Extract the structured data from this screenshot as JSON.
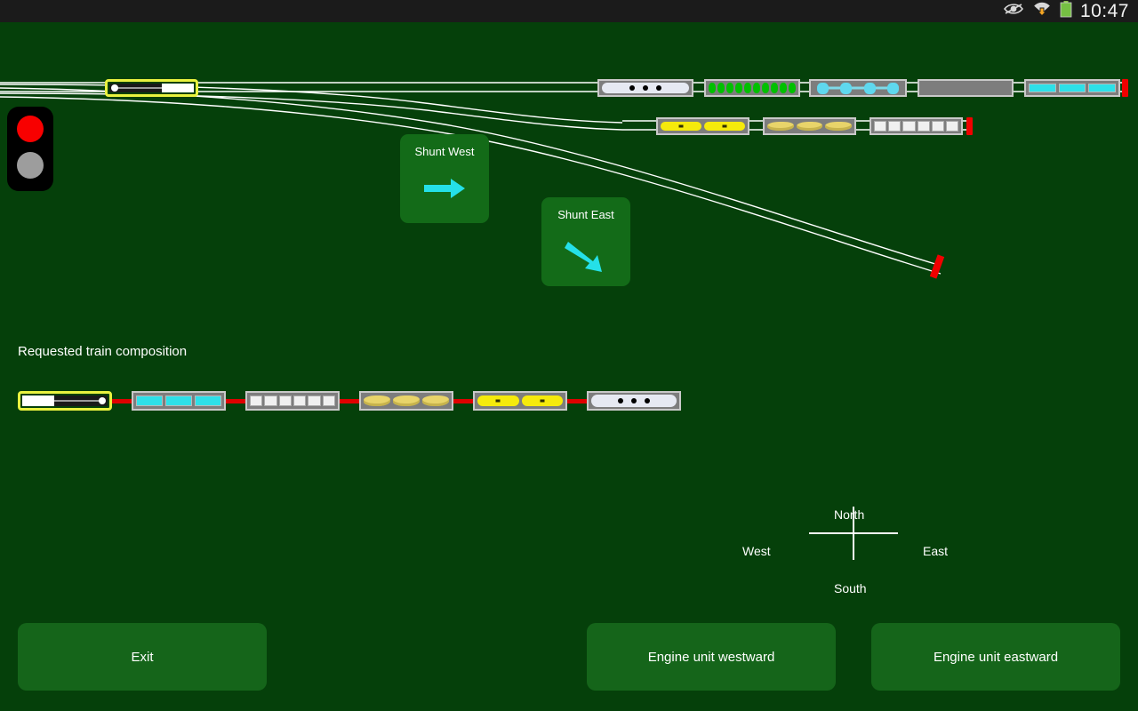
{
  "statusbar": {
    "clock": "10:47",
    "icons": [
      "eye-icon",
      "wifi-download-icon",
      "battery-icon"
    ]
  },
  "signal": {
    "name": "track-signal",
    "top_lamp_color": "#f80000",
    "bottom_lamp_color": "#9d9d9d",
    "aspect": "red"
  },
  "palette": {
    "background": "#05400a",
    "button_fill": "#15651a",
    "shunt_fill": "#136b18",
    "track": "#ffffff",
    "buffer_stop": "#f10000",
    "loco_highlight": "#e9f23f",
    "arrow": "#25e0e8"
  },
  "shunt_buttons": [
    {
      "label": "Shunt West",
      "arrow": "arrow-right-icon",
      "direction": "west"
    },
    {
      "label": "Shunt East",
      "arrow": "arrow-down-right-icon",
      "direction": "east"
    }
  ],
  "yard": {
    "track_north": [
      {
        "type": "locomotive",
        "facing": "east",
        "selected": true
      },
      {
        "type": "passenger",
        "cells": 3
      },
      {
        "type": "green-tank",
        "cells": 10
      },
      {
        "type": "diamond-load",
        "cells": 4
      },
      {
        "type": "flat-plain",
        "cells": 1
      },
      {
        "type": "cyan-container",
        "cells": 3
      }
    ],
    "track_middle": [
      {
        "type": "yellow-tank",
        "cells": 2
      },
      {
        "type": "hay",
        "cells": 3
      },
      {
        "type": "white-crate",
        "cells": 6
      }
    ],
    "buffer_stops": 3
  },
  "composition": {
    "title": "Requested train composition",
    "units": [
      {
        "type": "locomotive",
        "facing": "west",
        "selected": true
      },
      {
        "type": "cyan-container",
        "cells": 3
      },
      {
        "type": "white-crate",
        "cells": 6
      },
      {
        "type": "hay",
        "cells": 3
      },
      {
        "type": "yellow-tank",
        "cells": 2
      },
      {
        "type": "passenger",
        "cells": 3
      }
    ]
  },
  "compass": {
    "north": "North",
    "south": "South",
    "east": "East",
    "west": "West"
  },
  "buttons": {
    "exit": "Exit",
    "engine_west": "Engine unit westward",
    "engine_east": "Engine unit eastward"
  }
}
